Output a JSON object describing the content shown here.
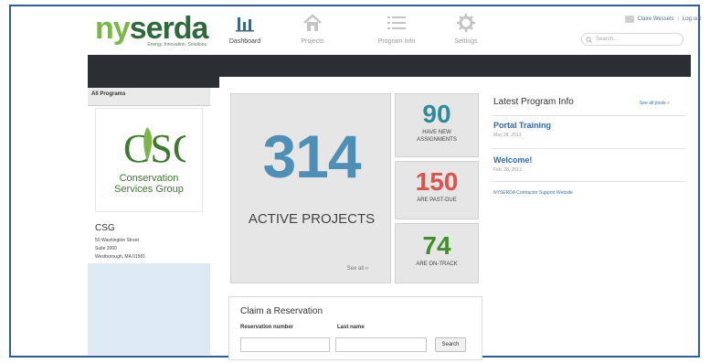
{
  "header": {
    "logo": {
      "brand_highlight": "ny",
      "brand_rest": "serda",
      "tagline": "Energy. Innovation. Solutions."
    },
    "nav": [
      {
        "label": "Dashboard",
        "icon": "bar-chart-icon",
        "active": true
      },
      {
        "label": "Projects",
        "icon": "home-icon",
        "active": false
      },
      {
        "label": "Program Info",
        "icon": "list-icon",
        "active": false
      },
      {
        "label": "Settings",
        "icon": "gear-icon",
        "active": false
      }
    ],
    "user": {
      "name": "Claire Wessels",
      "logout_label": "Log out"
    },
    "search": {
      "placeholder": "Search..."
    }
  },
  "sidebar": {
    "heading": "All Programs",
    "org": {
      "logo_mark": "CSG",
      "logo_line1": "Conservation",
      "logo_line2": "Services Group",
      "name": "CSG",
      "address_line1": "50 Washington Street",
      "address_line2": "Suite 3000",
      "address_line3": "Westborough, MA 01581"
    }
  },
  "stats": {
    "active": {
      "value": "314",
      "label": "ACTIVE PROJECTS",
      "link": "See all »"
    },
    "new_assignments": {
      "value": "90",
      "label_line1": "HAVE NEW",
      "label_line2": "ASSIGNMENTS"
    },
    "past_due": {
      "value": "150",
      "label": "ARE PAST-DUE"
    },
    "on_track": {
      "value": "74",
      "label": "ARE ON-TRACK"
    }
  },
  "claim": {
    "title": "Claim a Reservation",
    "reservation_label": "Reservation number",
    "lastname_label": "Last name",
    "reservation_value": "",
    "lastname_value": "",
    "button": "Search"
  },
  "info": {
    "title": "Latest Program Info",
    "see_all": "See all posts »",
    "posts": [
      {
        "title": "Portal Training",
        "date": "May 28, 2013"
      },
      {
        "title": "Welcome!",
        "date": "Feb. 28, 2013"
      }
    ],
    "link": "NYSERDA Contractor Support Website"
  },
  "colors": {
    "accent_blue": "#4d8fb6",
    "new_green": "#2e8b9a",
    "past_due_red": "#d9534f",
    "on_track_green": "#3f8f2b",
    "brand_green": "#7ab648",
    "link_blue": "#2f6ab0",
    "frame_border": "#2f5e9e"
  }
}
